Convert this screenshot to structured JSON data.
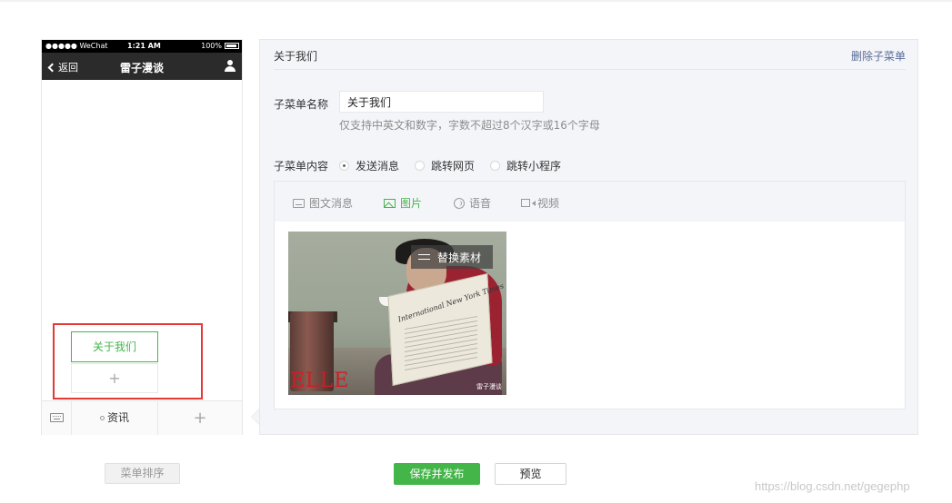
{
  "phone": {
    "status": {
      "carrier": "●●●●● WeChat ",
      "time": "1:21 AM",
      "battery": "100%"
    },
    "nav": {
      "back_label": "返回",
      "title": "雷子漫谈"
    },
    "submenu": {
      "item_label": "关于我们",
      "add_symbol": "+"
    },
    "menubar": {
      "main_label": "资讯",
      "add_symbol": "+"
    }
  },
  "editor": {
    "title": "关于我们",
    "delete_label": "删除子菜单",
    "name_label": "子菜单名称",
    "name_value": "关于我们",
    "name_hint": "仅支持中英文和数字，字数不超过8个汉字或16个字母",
    "content_label": "子菜单内容",
    "radio_options": [
      "发送消息",
      "跳转网页",
      "跳转小程序"
    ],
    "selected_radio": "发送消息",
    "tabs": [
      "图文消息",
      "图片",
      "语音",
      "视频"
    ],
    "active_tab": "图片",
    "replace_label": "替换素材",
    "image": {
      "paper_title": "International New York Times",
      "brand_mark": "ELLE",
      "watermark": "雷子漫谈"
    }
  },
  "buttons": {
    "sort": "菜单排序",
    "publish": "保存并发布",
    "preview": "预览"
  },
  "watermark": "https://blog.csdn.net/gegephp",
  "colors": {
    "accent": "#44b549",
    "link": "#576b95",
    "highlight": "#e53935"
  }
}
